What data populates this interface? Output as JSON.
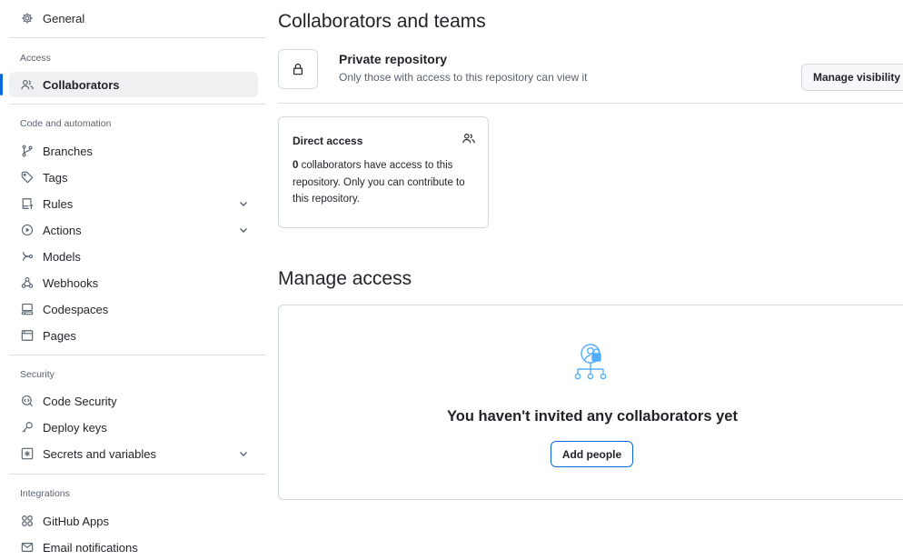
{
  "sidebar": {
    "general": "General",
    "sections": {
      "access": "Access",
      "code_automation": "Code and automation",
      "security": "Security",
      "integrations": "Integrations"
    },
    "items": {
      "collaborators": "Collaborators",
      "branches": "Branches",
      "tags": "Tags",
      "rules": "Rules",
      "actions": "Actions",
      "models": "Models",
      "webhooks": "Webhooks",
      "codespaces": "Codespaces",
      "pages": "Pages",
      "code_security": "Code Security",
      "deploy_keys": "Deploy keys",
      "secrets": "Secrets and variables",
      "github_apps": "GitHub Apps",
      "email_notifications": "Email notifications"
    }
  },
  "main": {
    "title": "Collaborators and teams",
    "repo_title": "Private repository",
    "repo_subtitle": "Only those with access to this repository can view it",
    "manage_visibility": "Manage visibility",
    "direct_access": {
      "title": "Direct access",
      "count": "0",
      "text": " collaborators have access to this repository. Only you can contribute to this repository."
    },
    "manage_access_title": "Manage access",
    "empty_title": "You haven't invited any collaborators yet",
    "add_people": "Add people"
  },
  "colors": {
    "accent": "#0969da",
    "selected_bg": "#eef0f2",
    "border": "#d0d7de",
    "muted": "#59636e",
    "empty_icon": "#54aeff"
  },
  "icons": {
    "general": "gear-icon",
    "collaborators": "people-icon",
    "branches": "git-branch-icon",
    "tags": "tag-icon",
    "rules": "repo-push-icon",
    "actions": "play-icon",
    "models": "models-icon",
    "webhooks": "webhook-icon",
    "codespaces": "codespaces-icon",
    "pages": "browser-icon",
    "code_security": "codescan-icon",
    "deploy_keys": "key-icon",
    "secrets": "asterisk-icon",
    "github_apps": "apps-icon",
    "email_notifications": "mail-icon"
  }
}
